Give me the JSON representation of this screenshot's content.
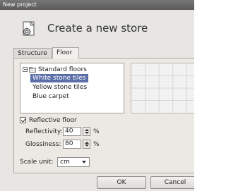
{
  "window": {
    "title": "New project"
  },
  "header": {
    "title": "Create a new store",
    "icon": "store-settings-icon"
  },
  "tabs": [
    {
      "label": "Structure",
      "active": false
    },
    {
      "label": "Floor",
      "active": true
    }
  ],
  "floor": {
    "tree": {
      "root_label": "Standard floors",
      "items": [
        {
          "label": "White stone tiles",
          "selected": true
        },
        {
          "label": "Yellow stone tiles",
          "selected": false
        },
        {
          "label": "Blue carpet",
          "selected": false
        }
      ]
    },
    "reflective_floor": {
      "label": "Reflective floor",
      "checked": true
    },
    "reflectivity": {
      "label": "Reflectivity:",
      "value": "40",
      "unit": "%"
    },
    "glossiness": {
      "label": "Glossiness:",
      "value": "80",
      "unit": "%"
    },
    "scale_unit": {
      "label": "Scale unit:",
      "value": "cm"
    }
  },
  "buttons": {
    "ok": "OK",
    "cancel": "Cancel"
  },
  "colors": {
    "selection": "#5b6fa8",
    "titlebar": "#636363"
  }
}
